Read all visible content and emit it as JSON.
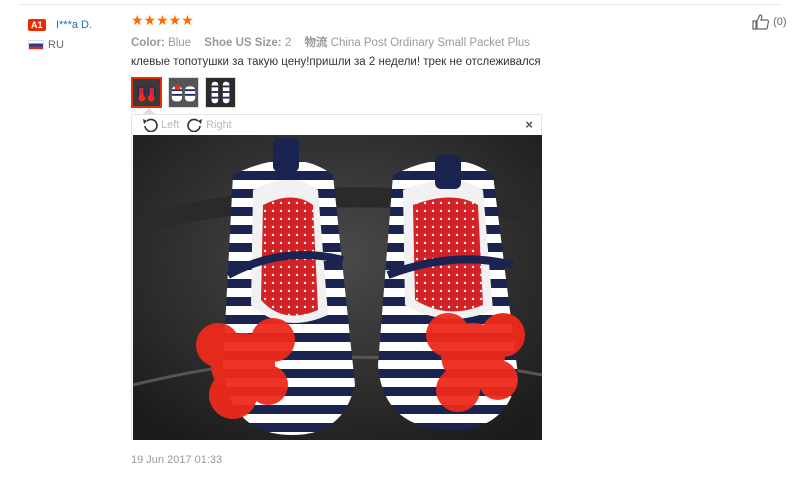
{
  "reviewer": {
    "badge": "A1",
    "name": "I***a D.",
    "country": "RU"
  },
  "rating": {
    "stars": "★★★★★",
    "value": 5,
    "max": 5
  },
  "attributes": [
    {
      "key": "Color:",
      "value": "Blue"
    },
    {
      "key": "Shoe US Size:",
      "value": "2"
    },
    {
      "key": "物流",
      "value": "China Post Ordinary Small Packet Plus"
    }
  ],
  "review_text": "клевые топотушки за такую цену!пришли за 2 недели! трек не отслеживался",
  "helpful": {
    "label": "(0)"
  },
  "viewer": {
    "rotate_left": "Left",
    "rotate_right": "Right",
    "close": "×"
  },
  "date": "19 Jun 2017 01:33",
  "colors": {
    "accent": "#ff6a00",
    "badge": "#e62e04",
    "link": "#1b6fbf"
  }
}
